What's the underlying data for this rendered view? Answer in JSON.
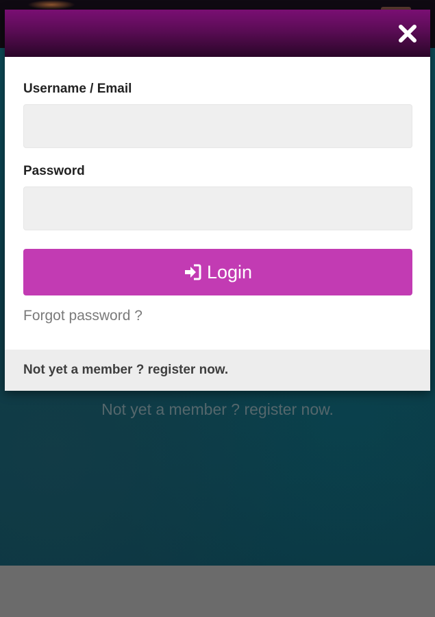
{
  "modal": {
    "close_icon": "close-icon",
    "username_label": "Username / Email",
    "username_value": "",
    "password_label": "Password",
    "password_value": "",
    "login_icon": "sign-in-icon",
    "login_label": "Login",
    "forgot_password": "Forgot password ?",
    "footer_register": "Not yet a member ? register now."
  },
  "background": {
    "register_text": "Not yet a member ? register now."
  },
  "colors": {
    "header_purple": "#7a0f73",
    "login_button": "#c23bb3",
    "hero_teal": "#0d4b58"
  }
}
